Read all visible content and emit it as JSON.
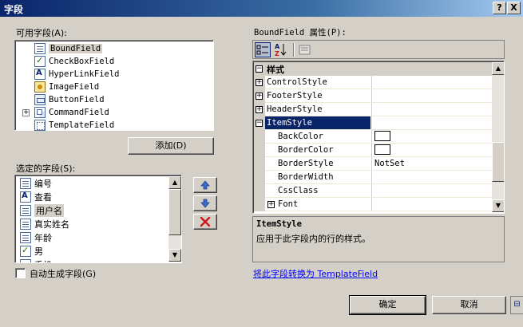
{
  "window": {
    "title": "字段",
    "help_glyph": "?",
    "close_glyph": "X"
  },
  "available_fields": {
    "label": "可用字段(A):",
    "items": [
      {
        "label": "BoundField",
        "icon": "bound-field-icon"
      },
      {
        "label": "CheckBoxField",
        "icon": "checkbox-field-icon"
      },
      {
        "label": "HyperLinkField",
        "icon": "hyperlink-field-icon"
      },
      {
        "label": "ImageField",
        "icon": "image-field-icon"
      },
      {
        "label": "ButtonField",
        "icon": "button-field-icon"
      },
      {
        "label": "CommandField",
        "icon": "command-field-icon",
        "expandable": true
      },
      {
        "label": "TemplateField",
        "icon": "template-field-icon"
      }
    ],
    "selected_index": 0
  },
  "add_button": "添加(D)",
  "selected_fields": {
    "label": "选定的字段(S):",
    "items": [
      {
        "label": "编号",
        "icon": "bound-field-icon"
      },
      {
        "label": "查看",
        "icon": "hyperlink-field-icon"
      },
      {
        "label": "用户名",
        "icon": "bound-field-icon"
      },
      {
        "label": "真实姓名",
        "icon": "bound-field-icon"
      },
      {
        "label": "年龄",
        "icon": "bound-field-icon"
      },
      {
        "label": "男",
        "icon": "checkbox-field-icon"
      },
      {
        "label": "手机",
        "icon": "bound-field-icon"
      }
    ],
    "selected_index": 2
  },
  "move_buttons": {
    "up_icon": "arrow-up-icon",
    "down_icon": "arrow-down-icon",
    "delete_icon": "delete-x-icon"
  },
  "auto_generate": {
    "label": "自动生成字段(G)",
    "checked": false
  },
  "properties": {
    "label": "BoundField 属性(P):",
    "category": "样式",
    "rows": [
      {
        "name": "ControlStyle",
        "value": "",
        "expander": "+",
        "indent": false
      },
      {
        "name": "FooterStyle",
        "value": "",
        "expander": "+",
        "indent": false
      },
      {
        "name": "HeaderStyle",
        "value": "",
        "expander": "+",
        "indent": false
      },
      {
        "name": "ItemStyle",
        "value": "",
        "expander": "−",
        "indent": false,
        "selected": true
      },
      {
        "name": "BackColor",
        "value": "",
        "indent": true,
        "color_swatch": true
      },
      {
        "name": "BorderColor",
        "value": "",
        "indent": true,
        "color_swatch": true
      },
      {
        "name": "BorderStyle",
        "value": "NotSet",
        "indent": true
      },
      {
        "name": "BorderWidth",
        "value": "",
        "indent": true
      },
      {
        "name": "CssClass",
        "value": "",
        "indent": true
      },
      {
        "name": "Font",
        "value": "",
        "expander": "+",
        "indent": true
      }
    ],
    "description_title": "ItemStyle",
    "description_text": "应用于此字段内的行的样式。"
  },
  "convert_link": "将此字段转换为 TemplateField",
  "ok_button": "确定",
  "cancel_button": "取消"
}
